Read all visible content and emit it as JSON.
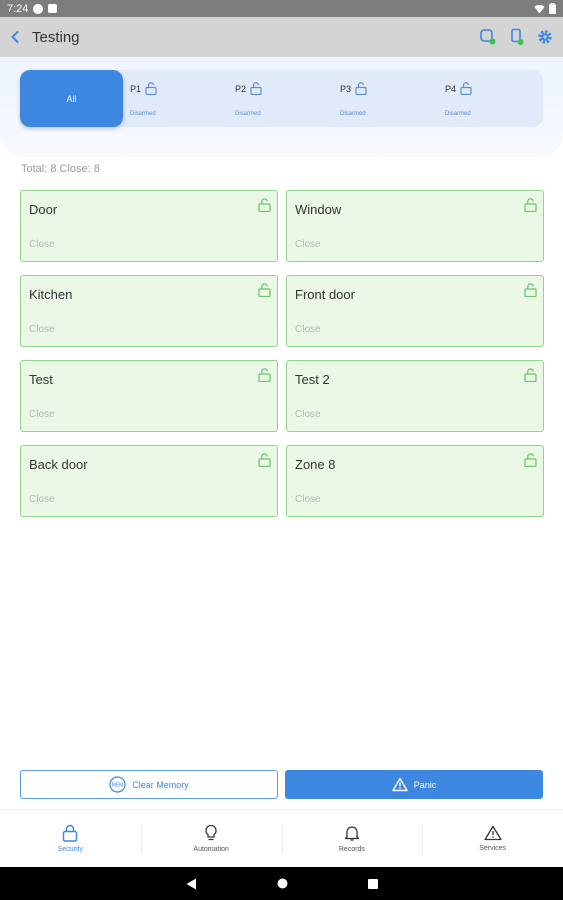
{
  "status_bar": {
    "time": "7:24"
  },
  "app_bar": {
    "title": "Testing"
  },
  "partitions": {
    "all_label": "All",
    "items": [
      {
        "name": "P1",
        "status": "Disarmed"
      },
      {
        "name": "P2",
        "status": "Disarmed"
      },
      {
        "name": "P3",
        "status": "Disarmed"
      },
      {
        "name": "P4",
        "status": "Disarmed"
      }
    ]
  },
  "summary": {
    "text": "Total: 8  Close: 8"
  },
  "zones": [
    {
      "name": "Door",
      "status": "Close"
    },
    {
      "name": "Window",
      "status": "Close"
    },
    {
      "name": "Kitchen",
      "status": "Close"
    },
    {
      "name": "Front door",
      "status": "Close"
    },
    {
      "name": "Test",
      "status": "Close"
    },
    {
      "name": "Test 2",
      "status": "Close"
    },
    {
      "name": "Back door",
      "status": "Close"
    },
    {
      "name": "Zone 8",
      "status": "Close"
    }
  ],
  "actions": {
    "clear_memory_label": "Clear Memory",
    "memory_badge": "MEM",
    "panic_label": "Panic"
  },
  "bottom_nav": [
    {
      "label": "Security",
      "icon": "lock-icon"
    },
    {
      "label": "Automation",
      "icon": "lightbulb-icon"
    },
    {
      "label": "Records",
      "icon": "bell-icon"
    },
    {
      "label": "Services",
      "icon": "warning-icon"
    }
  ],
  "colors": {
    "accent": "#3d87e0",
    "zone_bg": "#eaf8e5",
    "zone_border": "#8fd58c"
  }
}
